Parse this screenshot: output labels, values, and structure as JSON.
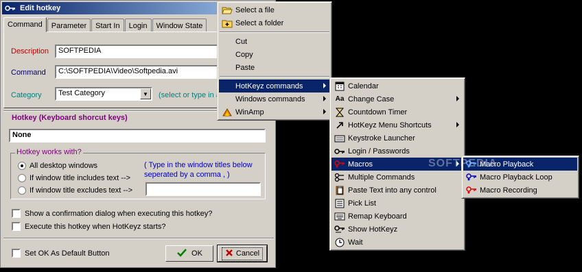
{
  "window": {
    "title": "Edit hotkey"
  },
  "tabs": [
    "Command",
    "Parameter",
    "Start In",
    "Login",
    "Window State"
  ],
  "form": {
    "description_label": "Description",
    "description_value": "SOFTPEDIA",
    "command_label": "Command",
    "command_value": "C:\\SOFTPEDIA\\Video\\Softpedia.avi",
    "category_label": "Category",
    "category_value": "Test Category",
    "category_hint": "(select or type in a"
  },
  "hotkey": {
    "title": "Hotkey (Keyboard shorcut keys)",
    "value": "None"
  },
  "works_with": {
    "title": "Hotkey works with?",
    "options": [
      "All desktop windows",
      "If window title includes text -->",
      "If window title excludes text -->"
    ],
    "selected_index": 0,
    "hint": "( Type in the window titles below seperated by a comma , )",
    "titles_value": ""
  },
  "checks": {
    "confirm": "Show a confirmation dialog when executing this hotkey?",
    "on_start": "Execute this hotkey when HotKeyz starts?",
    "ok_default": "Set OK As Default Button"
  },
  "buttons": {
    "ok": "OK",
    "cancel": "Cancel"
  },
  "menu1": {
    "items": [
      "Select a file",
      "Select a folder",
      "Cut",
      "Copy",
      "Paste",
      "HotKeyz commands",
      "Windows commands",
      "WinAmp"
    ]
  },
  "menu2": {
    "items": [
      "Calendar",
      "Change Case",
      "Countdown Timer",
      "HotKeyz Menu Shortcuts",
      "Keystroke Launcher",
      "Login / Passwords",
      "Macros",
      "Multiple Commands",
      "Paste Text into any control",
      "Pick List",
      "Remap Keyboard",
      "Show HotKeyz",
      "Wait"
    ]
  },
  "menu3": {
    "items": [
      "Macro Playback",
      "Macro Playback Loop",
      "Macro Recording"
    ]
  },
  "watermark": "SOFTPEDIA",
  "colors": {
    "menu_highlight": "#0a246a",
    "title_start": "#0a246a",
    "title_end": "#a6caf0",
    "desc_label": "#c00000",
    "command_label": "#00007f",
    "hint_teal": "#008080",
    "hotkey_title": "#800080"
  }
}
